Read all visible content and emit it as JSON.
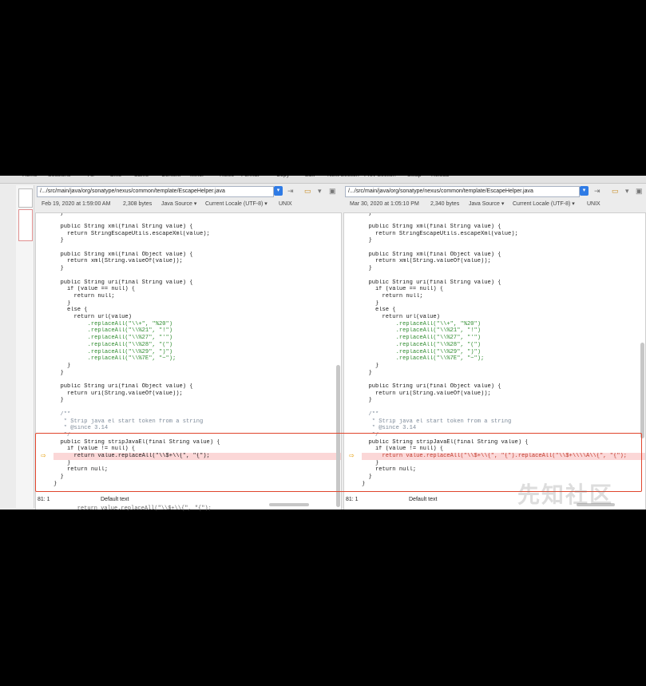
{
  "toolbar": {
    "items": [
      "Home",
      "Sessions",
      "All",
      "Diffs",
      "Same",
      "Context",
      "Minor",
      "Rules",
      "Format",
      "Copy",
      "Edit",
      "Next Section",
      "Prev Section",
      "Swap",
      "Reload"
    ]
  },
  "left": {
    "path": "/.../src/main/java/org/sonatype/nexus/common/template/EscapeHelper.java",
    "date": "Feb 19, 2020 at 1:59:00 AM",
    "size": "2,308 bytes",
    "format": "Java Source ▾",
    "encoding": "Current Locale (UTF-8) ▾",
    "eol": "UNIX",
    "position": "81: 1",
    "text_style": "Default text"
  },
  "right": {
    "path": "/.../src/main/java/org/sonatype/nexus/common/template/EscapeHelper.java",
    "date": "Mar 30, 2020 at 1:05:10 PM",
    "size": "2,340 bytes",
    "format": "Java Source ▾",
    "encoding": "Current Locale (UTF-8) ▾",
    "eol": "UNIX",
    "position": "81: 1",
    "text_style": "Default text"
  },
  "code_left": [
    "  }",
    "",
    "  public String xml(final String value) {",
    "    return StringEscapeUtils.escapeXml(value);",
    "  }",
    "",
    "  public String xml(final Object value) {",
    "    return xml(String.valueOf(value));",
    "  }",
    "",
    "  public String uri(final String value) {",
    "    if (value == null) {",
    "      return null;",
    "    }",
    "    else {",
    "      return url(value)",
    "          .replaceAll(\"\\\\+\", \"%20\")",
    "          .replaceAll(\"\\\\%21\", \"!\")",
    "          .replaceAll(\"\\\\%27\", \"'\")",
    "          .replaceAll(\"\\\\%28\", \"(\")",
    "          .replaceAll(\"\\\\%29\", \")\")",
    "          .replaceAll(\"\\\\%7E\", \"~\");",
    "    }",
    "  }",
    "",
    "  public String uri(final Object value) {",
    "    return uri(String.valueOf(value));",
    "  }",
    "",
    "  /**",
    "   * Strip java el start token from a string",
    "   * @since 3.14",
    "   */",
    "  public String stripJavaEl(final String value) {",
    "    if (value != null) {",
    "      return value.replaceAll(\"\\\\$+\\\\{\", \"{\");",
    "    }",
    "    return null;",
    "  }",
    "}"
  ],
  "code_right": [
    "  }",
    "",
    "  public String xml(final String value) {",
    "    return StringEscapeUtils.escapeXml(value);",
    "  }",
    "",
    "  public String xml(final Object value) {",
    "    return xml(String.valueOf(value));",
    "  }",
    "",
    "  public String uri(final String value) {",
    "    if (value == null) {",
    "      return null;",
    "    }",
    "    else {",
    "      return url(value)",
    "          .replaceAll(\"\\\\+\", \"%20\")",
    "          .replaceAll(\"\\\\%21\", \"!\")",
    "          .replaceAll(\"\\\\%27\", \"'\")",
    "          .replaceAll(\"\\\\%28\", \"(\")",
    "          .replaceAll(\"\\\\%29\", \")\")",
    "          .replaceAll(\"\\\\%7E\", \"~\");",
    "    }",
    "  }",
    "",
    "  public String uri(final Object value) {",
    "    return uri(String.valueOf(value));",
    "  }",
    "",
    "  /**",
    "   * Strip java el start token from a string",
    "   * @since 3.14",
    "   */",
    "  public String stripJavaEl(final String value) {",
    "    if (value != null) {",
    "      return value.replaceAll(\"\\\\$+\\\\{\", \"{\").replaceAll(\"\\\\$+\\\\\\\\A\\\\{\", \"{\");",
    "    }",
    "    return null;",
    "  }",
    "}"
  ],
  "diff_line_index": 35,
  "bottom_snippet": "    return value.replaceAll(\"\\\\$+\\\\{\", \"{\");",
  "watermark": "先知社区",
  "colors": {
    "highlight": "#e0452c",
    "diff_bg": "#fbd7d7",
    "path_dropdown": "#2f7be5"
  }
}
